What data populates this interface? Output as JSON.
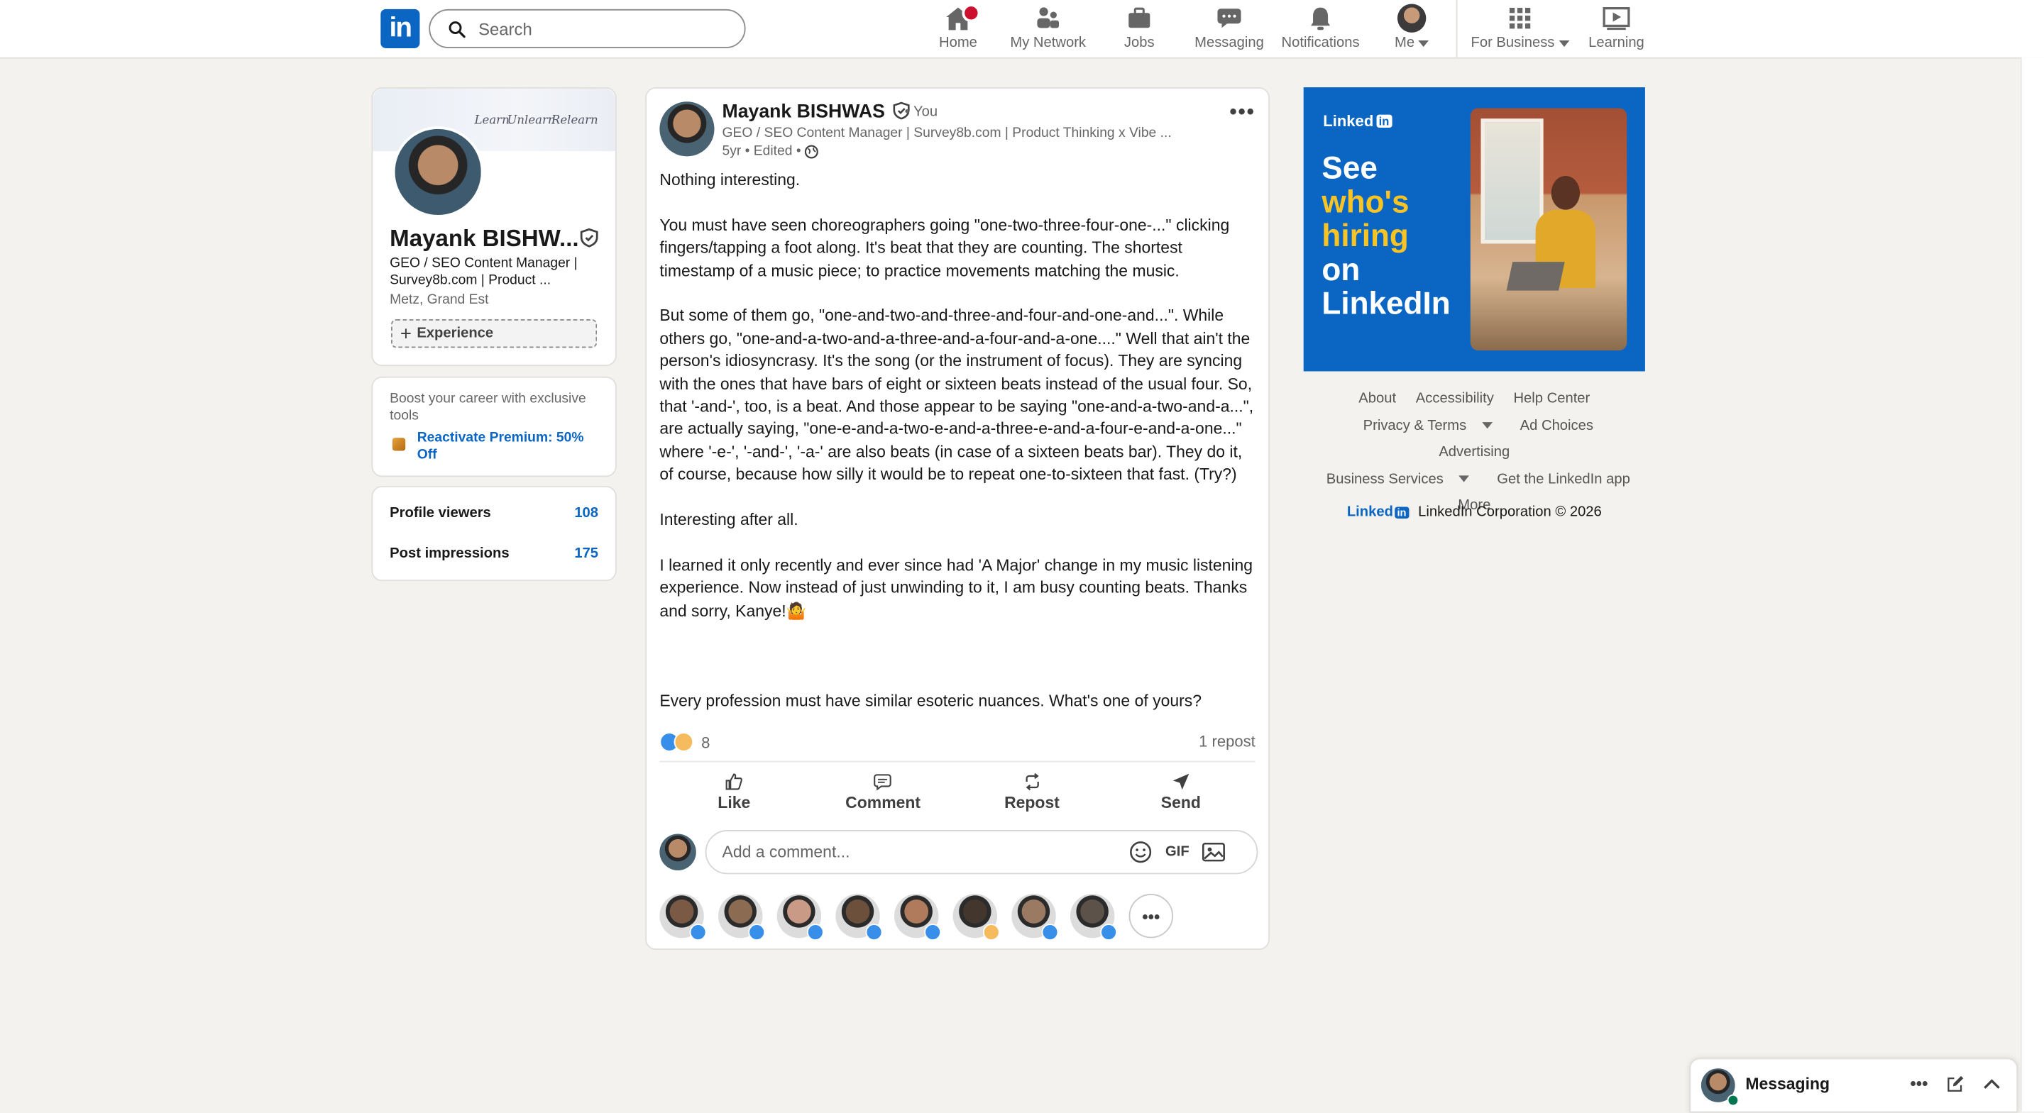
{
  "header": {
    "search_placeholder": "Search",
    "nav": [
      {
        "label": "Home",
        "icon": "home-icon"
      },
      {
        "label": "My Network",
        "icon": "network-icon"
      },
      {
        "label": "Jobs",
        "icon": "jobs-icon"
      },
      {
        "label": "Messaging",
        "icon": "messaging-icon"
      },
      {
        "label": "Notifications",
        "icon": "bell-icon"
      },
      {
        "label": "Me",
        "icon": "avatar"
      },
      {
        "label": "For Business",
        "icon": "grid-icon"
      },
      {
        "label": "Learning",
        "icon": "learning-icon"
      }
    ]
  },
  "profile": {
    "banner_script": [
      "Learn",
      "Unlearn",
      "Relearn"
    ],
    "name": "Mayank BISHW...",
    "headline": "GEO / SEO Content Manager | Survey8b.com | Product ...",
    "location": "Metz, Grand Est",
    "experience_button": "Experience"
  },
  "premium": {
    "text": "Boost your career with exclusive tools",
    "link": "Reactivate Premium: 50% Off"
  },
  "stats": [
    {
      "label": "Profile viewers",
      "value": "108"
    },
    {
      "label": "Post impressions",
      "value": "175"
    }
  ],
  "post": {
    "author": "Mayank BISHWAS",
    "you": "• You",
    "headline": "GEO / SEO Content Manager | Survey8b.com | Product Thinking x Vibe ...",
    "meta": "5yr • Edited •",
    "paragraphs": [
      "Nothing interesting.",
      "You must have seen choreographers going \"one-two-three-four-one-...\" clicking fingers/tapping a foot along. It's beat that they are counting. The shortest timestamp of a music piece; to practice movements matching the music.",
      "But some of them go, \"one-and-two-and-three-and-four-and-one-and...\". While others go, \"one-and-a-two-and-a-three-and-a-four-and-a-one....\" Well that ain't the person's idiosyncrasy. It's the song (or the instrument of focus). They are syncing with the ones that have bars of eight or sixteen beats instead of the usual four. So, that '-and-', too, is a beat. And those appear to be saying \"one-and-a-two-and-a...\", are actually saying, \"one-e-and-a-two-e-and-a-three-e-and-a-four-e-and-a-one...\" where '-e-', '-and-', '-a-' are also beats (in case of a sixteen beats bar). They do it, of course, because how silly it would be to repeat one-to-sixteen that fast. (Try?)",
      "Interesting after all.",
      "I learned it only recently and ever since had 'A Major' change in my music listening experience. Now instead of just unwinding to it, I am busy counting beats. Thanks and sorry, Kanye!🤷",
      "",
      "Every profession must have similar esoteric nuances. What's one of yours?"
    ],
    "reaction_count": "8",
    "repost_count": "1 repost",
    "actions": [
      "Like",
      "Comment",
      "Repost",
      "Send"
    ],
    "comment_placeholder": "Add a comment...",
    "gif_label": "GIF"
  },
  "reactors": [
    "#7a5a44",
    "#8b6b52",
    "#c99a85",
    "#6d503c",
    "#b07a5c",
    "#43362d",
    "#9a7a62",
    "#5d5249"
  ],
  "ad": {
    "brand": "Linked",
    "brand_in": "in",
    "line1": "See",
    "line2": "who's",
    "line3": "hiring",
    "line4": "on",
    "line5": "LinkedIn"
  },
  "footer": {
    "links_row1": [
      "About",
      "Accessibility",
      "Help Center"
    ],
    "links_row2": [
      "Privacy & Terms",
      "Ad Choices",
      "Advertising"
    ],
    "links_row3": [
      "Business Services",
      "Get the LinkedIn app"
    ],
    "links_row4": [
      "More"
    ],
    "brand": "Linked",
    "brand_in": "in",
    "copyright": "LinkedIn Corporation © 2026"
  },
  "messaging": {
    "title": "Messaging"
  },
  "colors": {
    "brand": "#0a66c2",
    "background": "#f4f2ee",
    "notification": "#cb112d",
    "ad_highlight": "#f8c325"
  }
}
